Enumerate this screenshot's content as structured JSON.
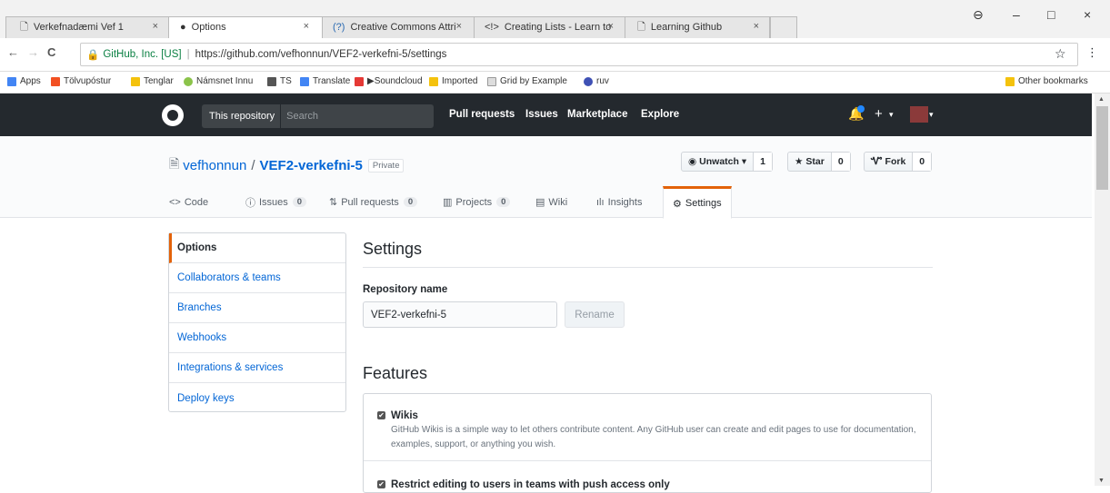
{
  "browser": {
    "tabs": [
      {
        "title": "Verkefnadæmi Vef 1",
        "icon": "page-icon"
      },
      {
        "title": "Options",
        "icon": "github-icon"
      },
      {
        "title": "Creative Commons Attri",
        "icon": "cc-icon",
        "prefix": "(?)"
      },
      {
        "title": "Creating Lists - Learn to",
        "icon": "code-icon",
        "prefix": "<!>"
      },
      {
        "title": "Learning Github",
        "icon": "page-icon"
      }
    ],
    "tab_close": "×",
    "window_controls": {
      "profile": "⊖",
      "minimize": "–",
      "maximize": "□",
      "close": "×"
    },
    "nav": {
      "back": "←",
      "forward": "→",
      "reload": "C"
    },
    "address": {
      "secure_label": "GitHub, Inc. [US]",
      "separator": "|",
      "url": "https://github.com/vefhonnun/VEF2-verkefni-5/settings"
    },
    "star": "☆",
    "menu": "⋮",
    "bookmarks": [
      {
        "label": "Apps",
        "color": "#4285f4"
      },
      {
        "label": "Tölvupóstur",
        "color": "#f25022"
      },
      {
        "label": "Tenglar",
        "color": "#f4c20d"
      },
      {
        "label": "Námsnet Innu",
        "color": "#8bc34a"
      },
      {
        "label": "TS",
        "color": "#555555"
      },
      {
        "label": "Translate",
        "color": "#4285f4"
      },
      {
        "label": "▶Soundcloud",
        "color": "#e53935"
      },
      {
        "label": "Imported",
        "color": "#f4c20d"
      },
      {
        "label": "Grid by Example",
        "color": "#dddddd"
      },
      {
        "label": "ruv",
        "color": "#3f51b5"
      }
    ],
    "other_bookmarks": "Other bookmarks"
  },
  "github": {
    "search_scope": "This repository",
    "search_placeholder": "Search",
    "nav": [
      "Pull requests",
      "Issues",
      "Marketplace",
      "Explore"
    ],
    "plus": "+",
    "caret": "▾"
  },
  "repo": {
    "owner": "vefhonnun",
    "slash": "/",
    "name": "VEF2-verkefni-5",
    "visibility": "Private",
    "actions": {
      "watch": {
        "label": "Unwatch ▾",
        "count": "1"
      },
      "star": {
        "label": "Star",
        "count": "0"
      },
      "fork": {
        "label": "Fork",
        "count": "0"
      }
    },
    "tabs": [
      {
        "label": "Code",
        "icon": "<>"
      },
      {
        "label": "Issues",
        "icon": "ⓘ",
        "count": "0"
      },
      {
        "label": "Pull requests",
        "icon": "⇅",
        "count": "0"
      },
      {
        "label": "Projects",
        "icon": "▥",
        "count": "0"
      },
      {
        "label": "Wiki",
        "icon": "▤"
      },
      {
        "label": "Insights",
        "icon": "ılı"
      },
      {
        "label": "Settings",
        "icon": "⚙"
      }
    ]
  },
  "settings": {
    "menu": [
      "Options",
      "Collaborators & teams",
      "Branches",
      "Webhooks",
      "Integrations & services",
      "Deploy keys"
    ],
    "heading": "Settings",
    "repo_name_label": "Repository name",
    "repo_name_value": "VEF2-verkefni-5",
    "rename_label": "Rename",
    "features_heading": "Features",
    "features": [
      {
        "title": "Wikis",
        "checked": true,
        "description": "GitHub Wikis is a simple way to let others contribute content. Any GitHub user can create and edit pages to use for documentation, examples, support, or anything you wish."
      },
      {
        "title": "Restrict editing to users in teams with push access only",
        "checked": true
      }
    ]
  }
}
